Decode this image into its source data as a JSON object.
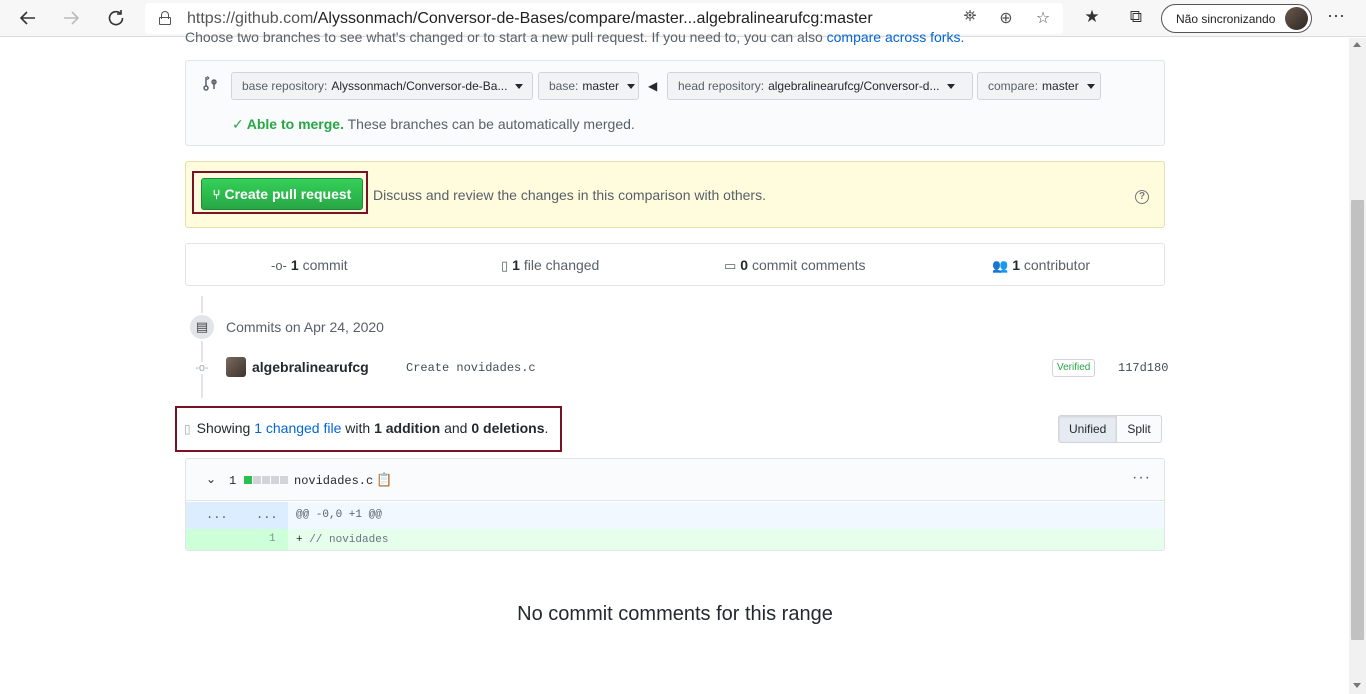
{
  "browser": {
    "url_prefix": "https://github.com",
    "url_path": "/Alyssonmach/Conversor-de-Bases/compare/master...algebralinearufcg:master",
    "profile_label": "Não sincronizando"
  },
  "page": {
    "intro_text": "Choose two branches to see what's changed or to start a new pull request. If you need to, you can also",
    "intro_link": "compare across forks."
  },
  "range": {
    "base_repo_label": "base repository:",
    "base_repo_value": "Alyssonmach/Conversor-de-Ba...",
    "base_label": "base:",
    "base_value": "master",
    "head_repo_label": "head repository:",
    "head_repo_value": "algebralinearufcg/Conversor-d...",
    "compare_label": "compare:",
    "compare_value": "master",
    "merge_status": "Able to merge.",
    "merge_detail": "These branches can be automatically merged."
  },
  "pull_request": {
    "button_label": "Create pull request",
    "description": "Discuss and review the changes in this comparison with others."
  },
  "stats": {
    "commits_count": "1",
    "commits_label": "commit",
    "files_count": "1",
    "files_label": "file changed",
    "comments_count": "0",
    "comments_label": "commit comments",
    "contributors_count": "1",
    "contributors_label": "contributor"
  },
  "commits": {
    "group_label": "Commits on Apr 24, 2020",
    "items": [
      {
        "author": "algebralinearufcg",
        "message": "Create novidades.c",
        "badge": "Verified",
        "sha": "117d180"
      }
    ]
  },
  "summary": {
    "prefix": "Showing",
    "changed_link": "1 changed file",
    "with": "with",
    "additions": "1 addition",
    "and": "and",
    "deletions": "0 deletions",
    "suffix": "."
  },
  "view_toggle": {
    "unified_label": "Unified",
    "split_label": "Split"
  },
  "diff": {
    "change_count": "1",
    "file_name": "novidades.c",
    "hunk_left": "...",
    "hunk_right": "...",
    "hunk_header": "@@ -0,0 +1 @@",
    "line_number": "1",
    "line_prefix": "+ ",
    "line_content": "// novidades",
    "more_label": "···"
  },
  "footer": {
    "no_comments": "No commit comments for this range"
  },
  "icons": {
    "back": "arrow-left-icon",
    "forward": "arrow-right-icon",
    "reload": "reload-icon",
    "lock": "lock-icon",
    "translate": "translate-icon",
    "zoom": "zoom-icon",
    "star": "star-icon",
    "favorites": "favorites-icon",
    "collections": "collections-icon",
    "compare": "git-compare-icon",
    "pull_request": "git-pull-request-icon",
    "commit": "git-commit-icon",
    "file_diff": "file-diff-icon",
    "comment": "comment-icon",
    "people": "people-icon"
  },
  "colors": {
    "primary_button": "#28a745",
    "link": "#0366d6",
    "highlight_frame": "#7a1225",
    "pr_box_bg": "#fffbdd"
  }
}
